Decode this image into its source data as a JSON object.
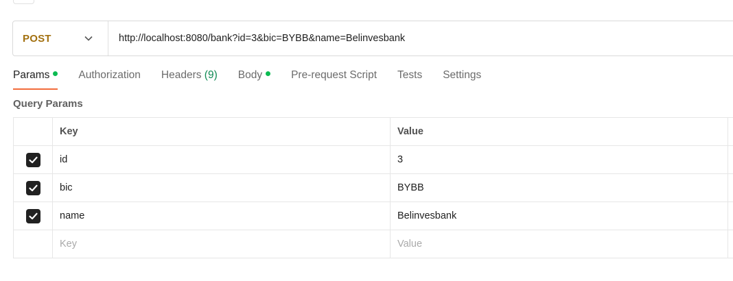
{
  "request": {
    "method": "POST",
    "url": "http://localhost:8080/bank?id=3&bic=BYBB&name=Belinvesbank"
  },
  "tabs": [
    {
      "label": "Params",
      "active": true,
      "dot": true
    },
    {
      "label": "Authorization"
    },
    {
      "label": "Headers",
      "count": "(9)"
    },
    {
      "label": "Body",
      "dot": true
    },
    {
      "label": "Pre-request Script"
    },
    {
      "label": "Tests"
    },
    {
      "label": "Settings"
    }
  ],
  "query_params": {
    "title": "Query Params",
    "columns": {
      "key": "Key",
      "value": "Value"
    },
    "rows": [
      {
        "checked": true,
        "key": "id",
        "value": "3"
      },
      {
        "checked": true,
        "key": "bic",
        "value": "BYBB"
      },
      {
        "checked": true,
        "key": "name",
        "value": "Belinvesbank"
      }
    ],
    "new_row": {
      "key_placeholder": "Key",
      "value_placeholder": "Value"
    }
  },
  "colors": {
    "method": "#a2700f",
    "active_tab_underline": "#f26b3a",
    "status_dot": "#0cbb52",
    "headers_count": "#0f8a53"
  },
  "icons": {
    "method_dropdown": "chevron-down-icon",
    "checkbox": "checkmark-icon"
  }
}
